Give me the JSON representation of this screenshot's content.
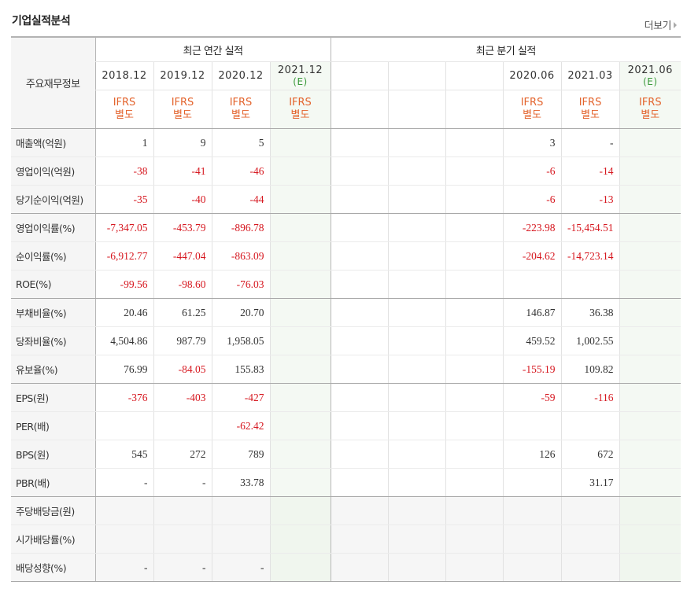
{
  "title": "기업실적분석",
  "more_label": "더보기",
  "corner_label": "주요재무정보",
  "annual_label": "최근 연간 실적",
  "quarter_label": "최근 분기 실적",
  "annual_periods": [
    {
      "year": "2018.12",
      "est": "",
      "top": "IFRS",
      "bottom": "별도"
    },
    {
      "year": "2019.12",
      "est": "",
      "top": "IFRS",
      "bottom": "별도"
    },
    {
      "year": "2020.12",
      "est": "",
      "top": "IFRS",
      "bottom": "별도"
    },
    {
      "year": "2021.12",
      "est": "(E)",
      "top": "IFRS",
      "bottom": "별도"
    }
  ],
  "quarter_periods": [
    {
      "year": "",
      "est": "",
      "top": "",
      "bottom": ""
    },
    {
      "year": "",
      "est": "",
      "top": "",
      "bottom": ""
    },
    {
      "year": "",
      "est": "",
      "top": "",
      "bottom": ""
    },
    {
      "year": "2020.06",
      "est": "",
      "top": "IFRS",
      "bottom": "별도"
    },
    {
      "year": "2021.03",
      "est": "",
      "top": "IFRS",
      "bottom": "별도"
    },
    {
      "year": "2021.06",
      "est": "(E)",
      "top": "IFRS",
      "bottom": "별도"
    }
  ],
  "rows": [
    {
      "label": "매출액(억원)",
      "a": [
        "1",
        "9",
        "5",
        ""
      ],
      "q": [
        "",
        "",
        "",
        "3",
        "-",
        ""
      ]
    },
    {
      "label": "영업이익(억원)",
      "a": [
        "-38",
        "-41",
        "-46",
        ""
      ],
      "q": [
        "",
        "",
        "",
        "-6",
        "-14",
        ""
      ]
    },
    {
      "label": "당기순이익(억원)",
      "a": [
        "-35",
        "-40",
        "-44",
        ""
      ],
      "q": [
        "",
        "",
        "",
        "-6",
        "-13",
        ""
      ]
    },
    {
      "label": "영업이익률(%)",
      "a": [
        "-7,347.05",
        "-453.79",
        "-896.78",
        ""
      ],
      "q": [
        "",
        "",
        "",
        "-223.98",
        "-15,454.51",
        ""
      ]
    },
    {
      "label": "순이익률(%)",
      "a": [
        "-6,912.77",
        "-447.04",
        "-863.09",
        ""
      ],
      "q": [
        "",
        "",
        "",
        "-204.62",
        "-14,723.14",
        ""
      ]
    },
    {
      "label": "ROE(%)",
      "a": [
        "-99.56",
        "-98.60",
        "-76.03",
        ""
      ],
      "q": [
        "",
        "",
        "",
        "",
        "",
        ""
      ]
    },
    {
      "label": "부채비율(%)",
      "a": [
        "20.46",
        "61.25",
        "20.70",
        ""
      ],
      "q": [
        "",
        "",
        "",
        "146.87",
        "36.38",
        ""
      ]
    },
    {
      "label": "당좌비율(%)",
      "a": [
        "4,504.86",
        "987.79",
        "1,958.05",
        ""
      ],
      "q": [
        "",
        "",
        "",
        "459.52",
        "1,002.55",
        ""
      ]
    },
    {
      "label": "유보율(%)",
      "a": [
        "76.99",
        "-84.05",
        "155.83",
        ""
      ],
      "q": [
        "",
        "",
        "",
        "-155.19",
        "109.82",
        ""
      ]
    },
    {
      "label": "EPS(원)",
      "a": [
        "-376",
        "-403",
        "-427",
        ""
      ],
      "q": [
        "",
        "",
        "",
        "-59",
        "-116",
        ""
      ]
    },
    {
      "label": "PER(배)",
      "a": [
        "",
        "",
        "-62.42",
        ""
      ],
      "q": [
        "",
        "",
        "",
        "",
        "",
        ""
      ]
    },
    {
      "label": "BPS(원)",
      "a": [
        "545",
        "272",
        "789",
        ""
      ],
      "q": [
        "",
        "",
        "",
        "126",
        "672",
        ""
      ]
    },
    {
      "label": "PBR(배)",
      "a": [
        "-",
        "-",
        "33.78",
        ""
      ],
      "q": [
        "",
        "",
        "",
        "",
        "31.17",
        ""
      ]
    },
    {
      "label": "주당배당금(원)",
      "a": [
        "",
        "",
        "",
        ""
      ],
      "q": [
        "",
        "",
        "",
        "",
        "",
        ""
      ]
    },
    {
      "label": "시가배당률(%)",
      "a": [
        "",
        "",
        "",
        ""
      ],
      "q": [
        "",
        "",
        "",
        "",
        "",
        ""
      ]
    },
    {
      "label": "배당성향(%)",
      "a": [
        "-",
        "-",
        "-",
        ""
      ],
      "q": [
        "",
        "",
        "",
        "",
        "",
        ""
      ]
    }
  ],
  "colors": {
    "negative": "#d6171f",
    "ifrs": "#e3632c",
    "estimate": "#3a9a3a",
    "estimate_bg": "#f4f9f3"
  }
}
